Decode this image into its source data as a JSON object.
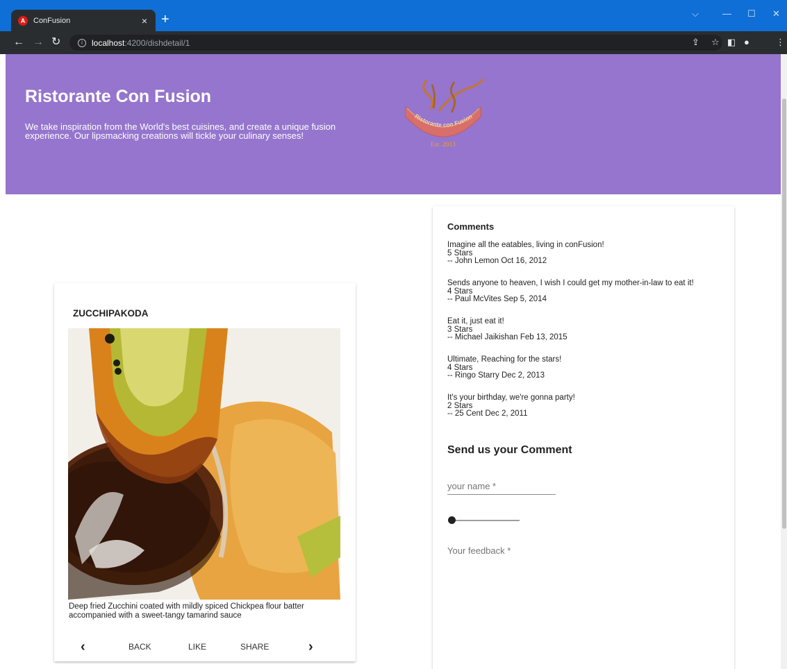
{
  "browser": {
    "tab_title": "ConFusion",
    "tab_favicon": "A",
    "tab_close": "×",
    "new_tab": "+",
    "url_host": "localhost",
    "url_rest": ":4200/dishdetail/1"
  },
  "header": {
    "title": "Ristorante Con Fusion",
    "tagline": "We take inspiration from the World's best cuisines, and create a unique fusion experience. Our lipsmacking creations will tickle your culinary senses!",
    "logo_text": "Ristorante con Fusion",
    "logo_est": "Est. 2013"
  },
  "dish": {
    "name": "ZUCCHIPAKODA",
    "description": "Deep fried Zucchini coated with mildly spiced Chickpea flour batter accompanied with a sweet-tangy tamarind sauce",
    "actions": {
      "back": "BACK",
      "like": "LIKE",
      "share": "SHARE"
    }
  },
  "comments": {
    "title": "Comments",
    "items": [
      {
        "text": "Imagine all the eatables, living in conFusion!",
        "rating": "5 Stars",
        "author": "-- John Lemon Oct 16, 2012"
      },
      {
        "text": "Sends anyone to heaven, I wish I could get my mother-in-law to eat it!",
        "rating": "4 Stars",
        "author": "-- Paul McVites Sep 5, 2014"
      },
      {
        "text": "Eat it, just eat it!",
        "rating": "3 Stars",
        "author": "-- Michael Jaikishan Feb 13, 2015"
      },
      {
        "text": "Ultimate, Reaching for the stars!",
        "rating": "4 Stars",
        "author": "-- Ringo Starry Dec 2, 2013"
      },
      {
        "text": "It's your birthday, we're gonna party!",
        "rating": "2 Stars",
        "author": "-- 25 Cent Dec 2, 2011"
      }
    ]
  },
  "form": {
    "title": "Send us your Comment",
    "name_placeholder": "your name *",
    "feedback_placeholder": "Your feedback *",
    "rating_value": 0
  },
  "colors": {
    "jumbotron": "#9575cd",
    "titlebar": "#0f6fd6",
    "logo_banner": "#d96f6a",
    "logo_gold": "#e8a33a"
  },
  "icons": {
    "back": "back-arrow-icon",
    "forward": "forward-arrow-icon",
    "reload": "reload-icon",
    "prev": "chevron-left-icon",
    "next": "chevron-right-icon"
  }
}
